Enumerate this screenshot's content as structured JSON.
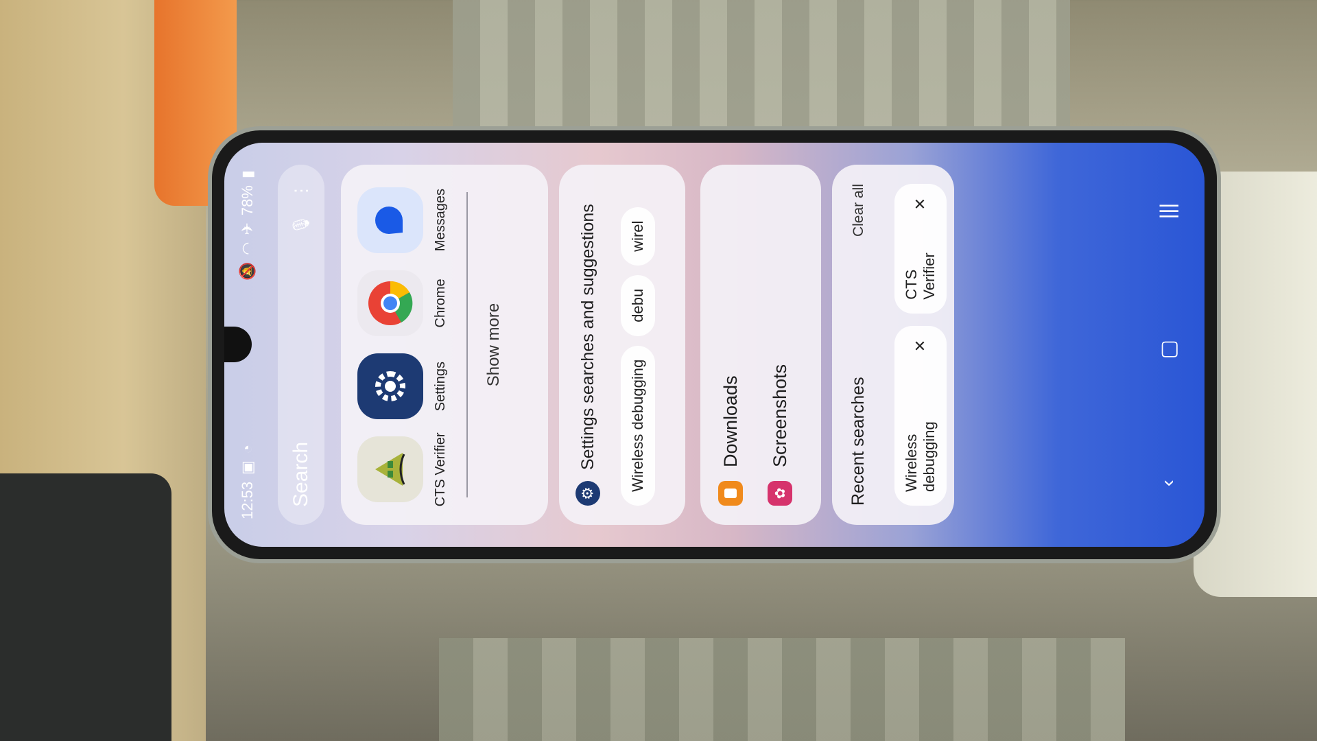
{
  "status": {
    "time": "12:53",
    "battery": "78%"
  },
  "search": {
    "placeholder": "Search"
  },
  "apps": [
    {
      "label": "CTS Verifier",
      "icon": "cts-verifier-icon"
    },
    {
      "label": "Settings",
      "icon": "settings-gear-icon"
    },
    {
      "label": "Chrome",
      "icon": "chrome-icon"
    },
    {
      "label": "Messages",
      "icon": "messages-icon"
    }
  ],
  "apps_card": {
    "show_more": "Show more"
  },
  "settings_card": {
    "title": "Settings searches and suggestions",
    "chips": [
      "Wireless debugging",
      "debu",
      "wirel"
    ]
  },
  "files_card": {
    "items": [
      "Downloads",
      "Screenshots"
    ]
  },
  "recent": {
    "title": "Recent searches",
    "clear_all": "Clear all",
    "items": [
      "Wireless debugging",
      "CTS Verifier"
    ]
  },
  "colors": {
    "settings_icon_bg": "#1d3a73",
    "messages_icon_bg": "#dbe5fb",
    "downloads": "#f08a1c",
    "screenshots": "#d6336c"
  }
}
